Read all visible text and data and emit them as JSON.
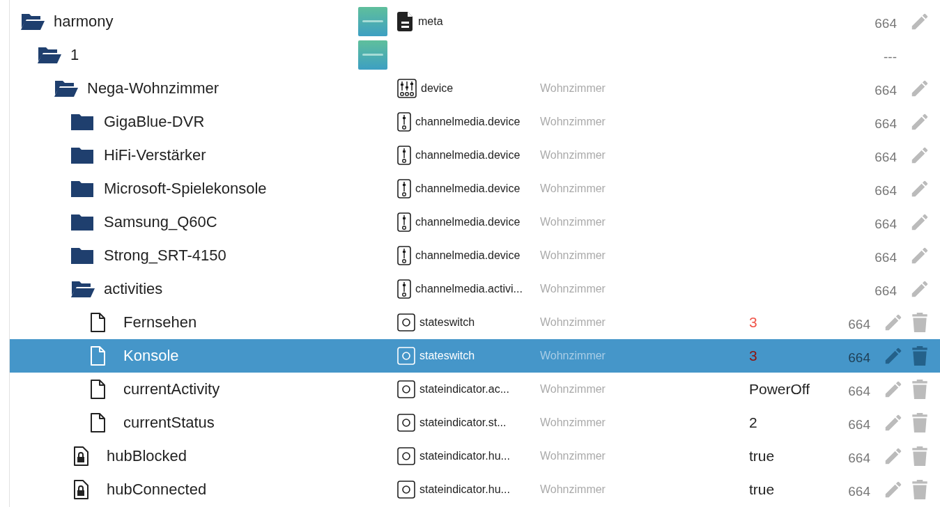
{
  "tree": [
    {
      "name": "harmony",
      "kind": "folder",
      "expanded": true,
      "selected": false,
      "type": {
        "kind": "meta",
        "label": "meta"
      },
      "acl": "664",
      "editable": true,
      "children": [
        {
          "name": "1",
          "kind": "folder",
          "expanded": true,
          "selected": false,
          "acl": "---",
          "children": [
            {
              "name": "Nega-Wohnzimmer",
              "kind": "folder",
              "expanded": true,
              "selected": false,
              "type": {
                "kind": "device",
                "label": "device"
              },
              "room": "Wohnzimmer",
              "acl": "664",
              "editable": true,
              "children": [
                {
                  "name": "GigaBlue-DVR",
                  "kind": "folder",
                  "expanded": false,
                  "selected": false,
                  "type": {
                    "kind": "channel",
                    "label": "channelmedia.device"
                  },
                  "room": "Wohnzimmer",
                  "acl": "664",
                  "editable": true
                },
                {
                  "name": "HiFi-Verstärker",
                  "kind": "folder",
                  "expanded": false,
                  "selected": false,
                  "type": {
                    "kind": "channel",
                    "label": "channelmedia.device"
                  },
                  "room": "Wohnzimmer",
                  "acl": "664",
                  "editable": true
                },
                {
                  "name": "Microsoft-Spielekonsole",
                  "kind": "folder",
                  "expanded": false,
                  "selected": false,
                  "type": {
                    "kind": "channel",
                    "label": "channelmedia.device"
                  },
                  "room": "Wohnzimmer",
                  "acl": "664",
                  "editable": true
                },
                {
                  "name": "Samsung_Q60C",
                  "kind": "folder",
                  "expanded": false,
                  "selected": false,
                  "type": {
                    "kind": "channel",
                    "label": "channelmedia.device"
                  },
                  "room": "Wohnzimmer",
                  "acl": "664",
                  "editable": true
                },
                {
                  "name": "Strong_SRT-4150",
                  "kind": "folder",
                  "expanded": false,
                  "selected": false,
                  "type": {
                    "kind": "channel",
                    "label": "channelmedia.device"
                  },
                  "room": "Wohnzimmer",
                  "acl": "664",
                  "editable": true
                },
                {
                  "name": "activities",
                  "kind": "folder",
                  "expanded": true,
                  "selected": false,
                  "type": {
                    "kind": "channel",
                    "label": "channelmedia.activi..."
                  },
                  "room": "Wohnzimmer",
                  "acl": "664",
                  "editable": true,
                  "children": [
                    {
                      "name": "Fernsehen",
                      "kind": "file",
                      "selected": false,
                      "type": {
                        "kind": "state",
                        "label": "stateswitch"
                      },
                      "room": "Wohnzimmer",
                      "value": {
                        "text": "3",
                        "color": "#f0554a"
                      },
                      "acl": "664",
                      "editable": true,
                      "deletable": true
                    },
                    {
                      "name": "Konsole",
                      "kind": "file",
                      "selected": true,
                      "type": {
                        "kind": "state",
                        "label": "stateswitch"
                      },
                      "room": "Wohnzimmer",
                      "value": {
                        "text": "3",
                        "color": "#8e1410"
                      },
                      "acl": "664",
                      "editable": true,
                      "deletable": true
                    },
                    {
                      "name": "currentActivity",
                      "kind": "file",
                      "selected": false,
                      "type": {
                        "kind": "state",
                        "label": "stateindicator.ac..."
                      },
                      "room": "Wohnzimmer",
                      "value": {
                        "text": "PowerOff",
                        "color": "#222222"
                      },
                      "acl": "664",
                      "editable": true,
                      "deletable": true
                    },
                    {
                      "name": "currentStatus",
                      "kind": "file",
                      "selected": false,
                      "type": {
                        "kind": "state",
                        "label": "stateindicator.st..."
                      },
                      "room": "Wohnzimmer",
                      "value": {
                        "text": "2",
                        "color": "#222222"
                      },
                      "acl": "664",
                      "editable": true,
                      "deletable": true
                    }
                  ]
                },
                {
                  "name": "hubBlocked",
                  "kind": "locked-file",
                  "selected": false,
                  "type": {
                    "kind": "state",
                    "label": "stateindicator.hu..."
                  },
                  "room": "Wohnzimmer",
                  "value": {
                    "text": "true",
                    "color": "#222222"
                  },
                  "acl": "664",
                  "editable": true,
                  "deletable": true
                },
                {
                  "name": "hubConnected",
                  "kind": "locked-file",
                  "selected": false,
                  "type": {
                    "kind": "state",
                    "label": "stateindicator.hu..."
                  },
                  "room": "Wohnzimmer",
                  "value": {
                    "text": "true",
                    "color": "#222222"
                  },
                  "acl": "664",
                  "editable": true,
                  "deletable": true
                }
              ]
            }
          ]
        }
      ]
    }
  ]
}
